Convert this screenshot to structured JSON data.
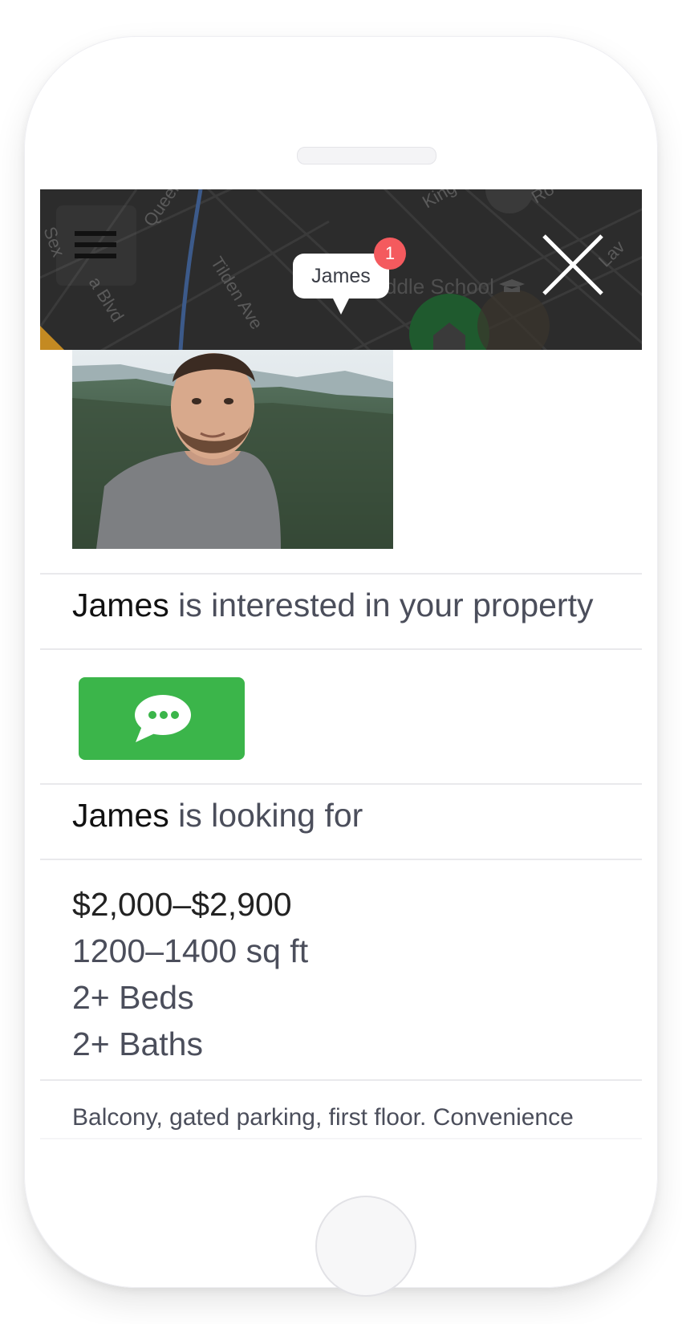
{
  "map": {
    "street_labels": [
      "Queen",
      "Tilden Ave",
      "a Blvd",
      "King",
      "Ro",
      "Lav",
      "Sex"
    ],
    "poi_label": "ddle School",
    "pin": {
      "name": "James",
      "badge_count": "1"
    }
  },
  "header": {
    "menu_icon": "hamburger-menu-icon",
    "close_icon": "close-x-icon"
  },
  "profile": {
    "photo": "profile-photo-of-james",
    "name": "James",
    "interest_text": "is interested in your property",
    "message_button_icon": "chat-bubble-icon"
  },
  "looking_for": {
    "name": "James",
    "text": "is looking for",
    "price": "$2,000–$2,900",
    "size": "1200–1400 sq ft",
    "beds": "2+ Beds",
    "baths": "2+ Baths"
  },
  "notes": "Balcony, gated parking, first floor. Convenience",
  "colors": {
    "map_bg": "#2c2c2c",
    "message_button": "#3bb54a",
    "badge": "#f45a5e",
    "text_muted": "#4b4e5b",
    "text_strong": "#111111"
  }
}
